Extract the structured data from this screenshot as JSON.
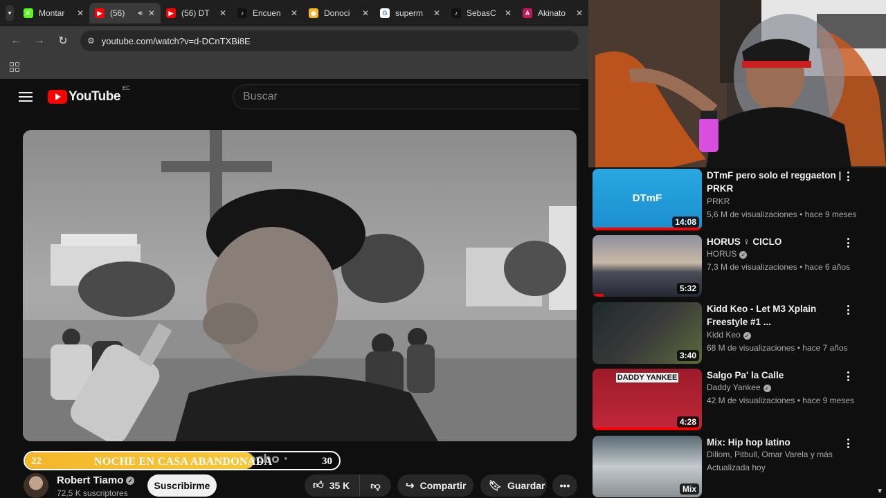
{
  "browser": {
    "tabs": [
      {
        "title": "Montar",
        "favicon_color": "#53fc18",
        "favicon_glyph": "K"
      },
      {
        "title": "(56)",
        "favicon_color": "#ff0000",
        "favicon_glyph": "▶",
        "active": true,
        "audio": true
      },
      {
        "title": "(56) DT",
        "favicon_color": "#ff0000",
        "favicon_glyph": "▶"
      },
      {
        "title": "Encuen",
        "favicon_color": "#111111",
        "favicon_glyph": "♪"
      },
      {
        "title": "Donoci",
        "favicon_color": "#f5b62a",
        "favicon_glyph": "◉"
      },
      {
        "title": "superm",
        "favicon_color": "#ffffff",
        "favicon_glyph": "G"
      },
      {
        "title": "SebasC",
        "favicon_color": "#111111",
        "favicon_glyph": "♪"
      },
      {
        "title": "Akinato",
        "favicon_color": "#c2185b",
        "favicon_glyph": "A"
      }
    ],
    "url": "youtube.com/watch?v=d-DCnTXBi8E"
  },
  "youtube": {
    "logo_text": "YouTube",
    "country_code": "EC",
    "search_placeholder": "Buscar"
  },
  "video": {
    "title_ghost": "Hocho ·",
    "overlay": {
      "left_number": "22",
      "title": "NOCHE EN CASA ABANDONADA",
      "right_number": "30",
      "progress": 0.73,
      "color": "#f5b62a"
    },
    "channel": {
      "name": "Robert Tiamo",
      "subscribers": "72,5 K suscriptores"
    },
    "subscribe_label": "Suscribirme",
    "likes": "35 K",
    "share_label": "Compartir",
    "save_label": "Guardar"
  },
  "recommendations": [
    {
      "title": "DTmF pero solo el reggaeton | PRKR",
      "channel": "PRKR",
      "verified": false,
      "meta": "5,6 M de visualizaciones • hace 9 meses",
      "duration": "14:08",
      "thumb_text": "DTmF",
      "watched": 1.0
    },
    {
      "title": "HORUS ♀ CICLO",
      "channel": "HORUS",
      "verified": true,
      "meta": "7,3 M de visualizaciones • hace 6 años",
      "duration": "5:32",
      "thumb_text": "",
      "watched": 0.1
    },
    {
      "title": "Kidd Keo - Let M3 Xplain Freestyle #1 ...",
      "channel": "Kidd Keo",
      "verified": true,
      "meta": "68 M de visualizaciones • hace 7 años",
      "duration": "3:40",
      "thumb_text": "",
      "watched": 0
    },
    {
      "title": "Salgo Pa' la Calle",
      "channel": "Daddy Yankee",
      "verified": true,
      "meta": "42 M de visualizaciones • hace 9 meses",
      "duration": "4:28",
      "thumb_text": "DADDY YANKEE",
      "watched": 1.0
    },
    {
      "title": "Mix: Hip hop latino",
      "channel": "Dillom, Pitbull, Omar Varela y más",
      "verified": false,
      "meta": "Actualizada hoy",
      "duration": "Mix",
      "thumb_text": "",
      "watched": 0
    }
  ]
}
